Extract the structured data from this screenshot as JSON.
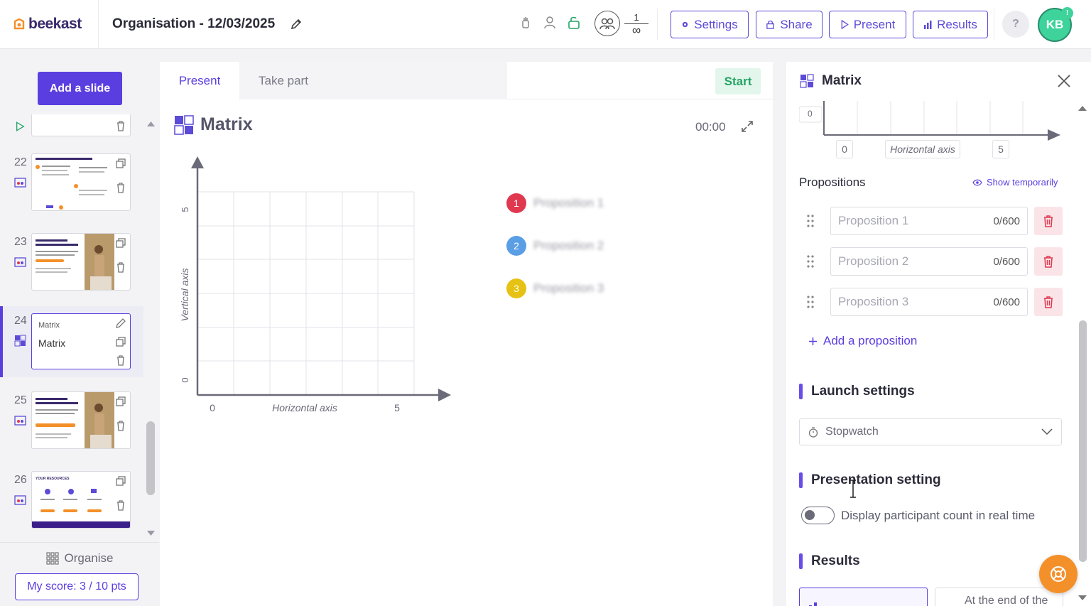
{
  "header": {
    "logo_text": "beekast",
    "title": "Organisation - 12/03/2025",
    "participants_current": "1",
    "participants_max": "∞",
    "buttons": {
      "settings": "Settings",
      "share": "Share",
      "present": "Present",
      "results": "Results"
    },
    "help": "?",
    "avatar_initials": "KB",
    "avatar_badge": "!"
  },
  "sidebar": {
    "add_slide": "Add a slide",
    "slides": [
      {
        "number": "22",
        "kind": "thumbnail"
      },
      {
        "number": "23",
        "kind": "thumbnail"
      },
      {
        "number": "24",
        "kind": "matrix",
        "type_label": "Matrix",
        "title": "Matrix"
      },
      {
        "number": "25",
        "kind": "thumbnail"
      },
      {
        "number": "26",
        "kind": "thumbnail",
        "caption": "YOUR RESOURCES"
      }
    ],
    "organise": "Organise",
    "score": "My score: 3 / 10 pts"
  },
  "main": {
    "tabs": {
      "present": "Present",
      "take_part": "Take part"
    },
    "start": "Start",
    "slide_title": "Matrix",
    "timer": "00:00",
    "matrix": {
      "vertical_axis": "Vertical axis",
      "horizontal_axis": "Horizontal axis",
      "x_min": "0",
      "x_max": "5",
      "y_min": "0",
      "y_max": "5"
    },
    "propositions": [
      {
        "number": "1",
        "label": "Proposition 1",
        "color": "#e0384f"
      },
      {
        "number": "2",
        "label": "Proposition 2",
        "color": "#5a9ee6"
      },
      {
        "number": "3",
        "label": "Proposition 3",
        "color": "#e6c214"
      }
    ]
  },
  "panel": {
    "title": "Matrix",
    "axis": {
      "min": "0",
      "label": "Horizontal axis",
      "max": "5",
      "vertical_min": "0"
    },
    "propositions_heading": "Propositions",
    "show_temporarily": "Show temporarily",
    "propositions": [
      {
        "placeholder": "Proposition 1",
        "count": "0/600"
      },
      {
        "placeholder": "Proposition 2",
        "count": "0/600"
      },
      {
        "placeholder": "Proposition 3",
        "count": "0/600"
      }
    ],
    "add_proposition": "Add a proposition",
    "launch_settings": "Launch settings",
    "launch_select": "Stopwatch",
    "presentation_setting": "Presentation setting",
    "toggle_label": "Display participant count in real time",
    "toggle_on": false,
    "results_heading": "Results",
    "results_option_2": "At the end of the"
  },
  "colors": {
    "accent": "#5b3ee0",
    "start_green": "#25a466",
    "fab": "#f4902a"
  }
}
